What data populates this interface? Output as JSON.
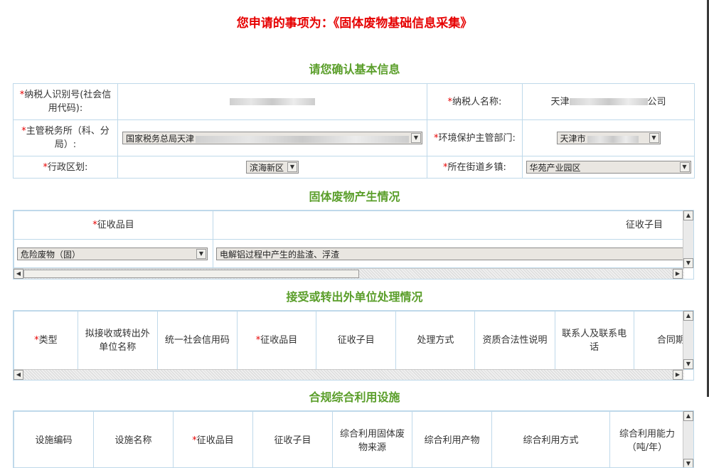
{
  "page_title": "您申请的事项为：《固体废物基础信息采集》",
  "sections": {
    "basic": "请您确认基本信息",
    "production": "固体废物产生情况",
    "transfer": "接受或转出外单位处理情况",
    "facilities": "合规综合利用设施"
  },
  "required_mark": "*",
  "basic_info": {
    "taxpayer_id_label": "纳税人识别号(社会信用代码):",
    "taxpayer_name_label": "纳税人名称:",
    "taxpayer_name_prefix": "天津",
    "taxpayer_name_suffix": "公司",
    "tax_office_label": "主管税务所（科、分局）:",
    "tax_office_value": "国家税务总局天津",
    "env_dept_label": "环境保护主管部门:",
    "env_dept_value": "天津市",
    "district_label": "行政区划:",
    "district_value": "滨海新区",
    "street_label": "所在街道乡镇:",
    "street_value": "华苑产业园区"
  },
  "production": {
    "headers": [
      "征收品目",
      "征收子目"
    ],
    "item_value": "危险废物（固）",
    "subitem_value": "电解铝过程中产生的盐渣、浮渣"
  },
  "transfer": {
    "headers": [
      "类型",
      "拟接收或转出外单位名称",
      "统一社会信用码",
      "征收品目",
      "征收子目",
      "处理方式",
      "资质合法性说明",
      "联系人及联系电话",
      "合同期止"
    ]
  },
  "facilities": {
    "headers": [
      "设施编码",
      "设施名称",
      "征收品目",
      "征收子目",
      "综合利用固体废物来源",
      "综合利用产物",
      "综合利用方式",
      "综合利用能力（吨/年）"
    ]
  },
  "icons": {
    "dropdown": "▼",
    "scroll_up": "▲",
    "scroll_down": "▼",
    "scroll_left": "◀",
    "scroll_right": "▶"
  },
  "colors": {
    "title_red": "#e60000",
    "section_green": "#5a9e2a",
    "border_blue": "#bfd9ea"
  }
}
